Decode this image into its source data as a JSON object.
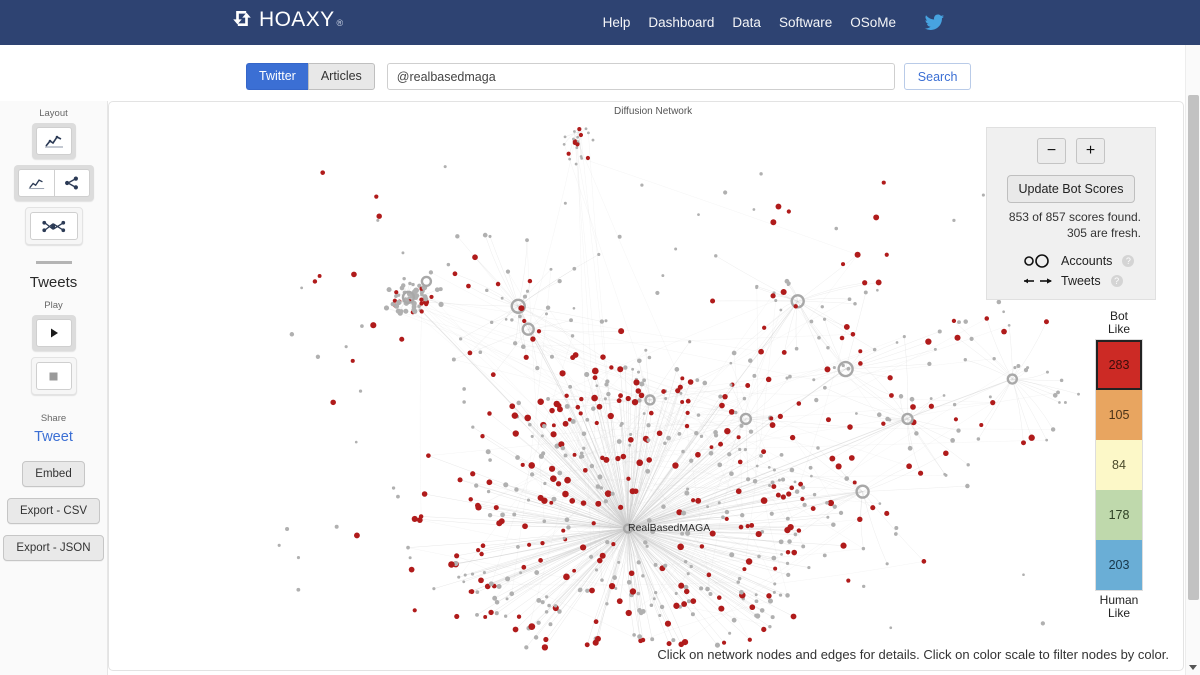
{
  "header": {
    "brand": "HOAXY",
    "brand_reg": "®",
    "brand_icon": "retweet-icon",
    "nav": [
      {
        "label": "Help"
      },
      {
        "label": "Dashboard"
      },
      {
        "label": "Data"
      },
      {
        "label": "Software"
      },
      {
        "label": "OSoMe"
      }
    ],
    "twitter_icon": "twitter-bird-icon",
    "bg_color": "#2e4372"
  },
  "search": {
    "toggle_twitter": "Twitter",
    "toggle_articles": "Articles",
    "active_toggle": "Twitter",
    "query": "@realbasedmaga",
    "placeholder": "@realbasedmaga",
    "search_button": "Search",
    "accent_color": "#3b6fd4"
  },
  "sidebar": {
    "layout_label": "Layout",
    "layout_buttons": [
      {
        "name": "layout-timeline",
        "icon": "line-chart-icon"
      },
      {
        "name": "layout-split",
        "icons": [
          "line-chart-icon",
          "share-network-icon"
        ]
      },
      {
        "name": "layout-network",
        "icon": "network-graph-icon"
      }
    ],
    "tweets_title": "Tweets",
    "play_label": "Play",
    "play_icon": "play-triangle-icon",
    "stop_icon": "stop-square-icon",
    "share_label": "Share",
    "tweet_link": "Tweet",
    "buttons": [
      {
        "label": "Embed"
      },
      {
        "label": "Export - CSV"
      },
      {
        "label": "Export - JSON"
      }
    ]
  },
  "panel": {
    "title": "Diffusion Network",
    "footer": "Click on network nodes and edges for details. Click on color scale to filter nodes by color.",
    "hub_label": "RealBasedMAGA"
  },
  "controls": {
    "zoom_out": "−",
    "zoom_in": "+",
    "update_button": "Update Bot Scores",
    "scores_line1": "853 of 857 scores found.",
    "scores_line2": "305 are fresh.",
    "legend": [
      {
        "label": "Accounts",
        "glyph": "two-circles-icon",
        "help": "?"
      },
      {
        "label": "Tweets",
        "glyph": "two-arrows-icon",
        "help": "?"
      }
    ]
  },
  "color_scale": {
    "top_label_line1": "Bot",
    "top_label_line2": "Like",
    "bottom_label_line1": "Human",
    "bottom_label_line2": "Like",
    "bands": [
      {
        "count": "283",
        "color": "#cc2a25",
        "text_color": "#3a0d0b",
        "selected": true
      },
      {
        "count": "105",
        "color": "#e8a560",
        "text_color": "#4a3318",
        "selected": false
      },
      {
        "count": "84",
        "color": "#fcf8c8",
        "text_color": "#4a4a2a",
        "selected": false
      },
      {
        "count": "178",
        "color": "#bfd9ac",
        "text_color": "#2d4024",
        "selected": false
      },
      {
        "count": "203",
        "color": "#6aaed6",
        "text_color": "#17374a",
        "selected": false
      }
    ]
  },
  "chart_data": {
    "type": "network",
    "title": "Diffusion Network",
    "hub_node": "RealBasedMAGA",
    "total_nodes": 857,
    "scored_nodes": 853,
    "fresh_scores": 305,
    "node_color_counts": {
      "bot_like_red": 283,
      "orange": 105,
      "neutral_yellow": 84,
      "green": 178,
      "human_like_blue": 203
    },
    "node_colors": {
      "bot": "#b01b1b",
      "neutral": "#b0b0b0"
    },
    "edge_color": "#c9c9c9"
  }
}
